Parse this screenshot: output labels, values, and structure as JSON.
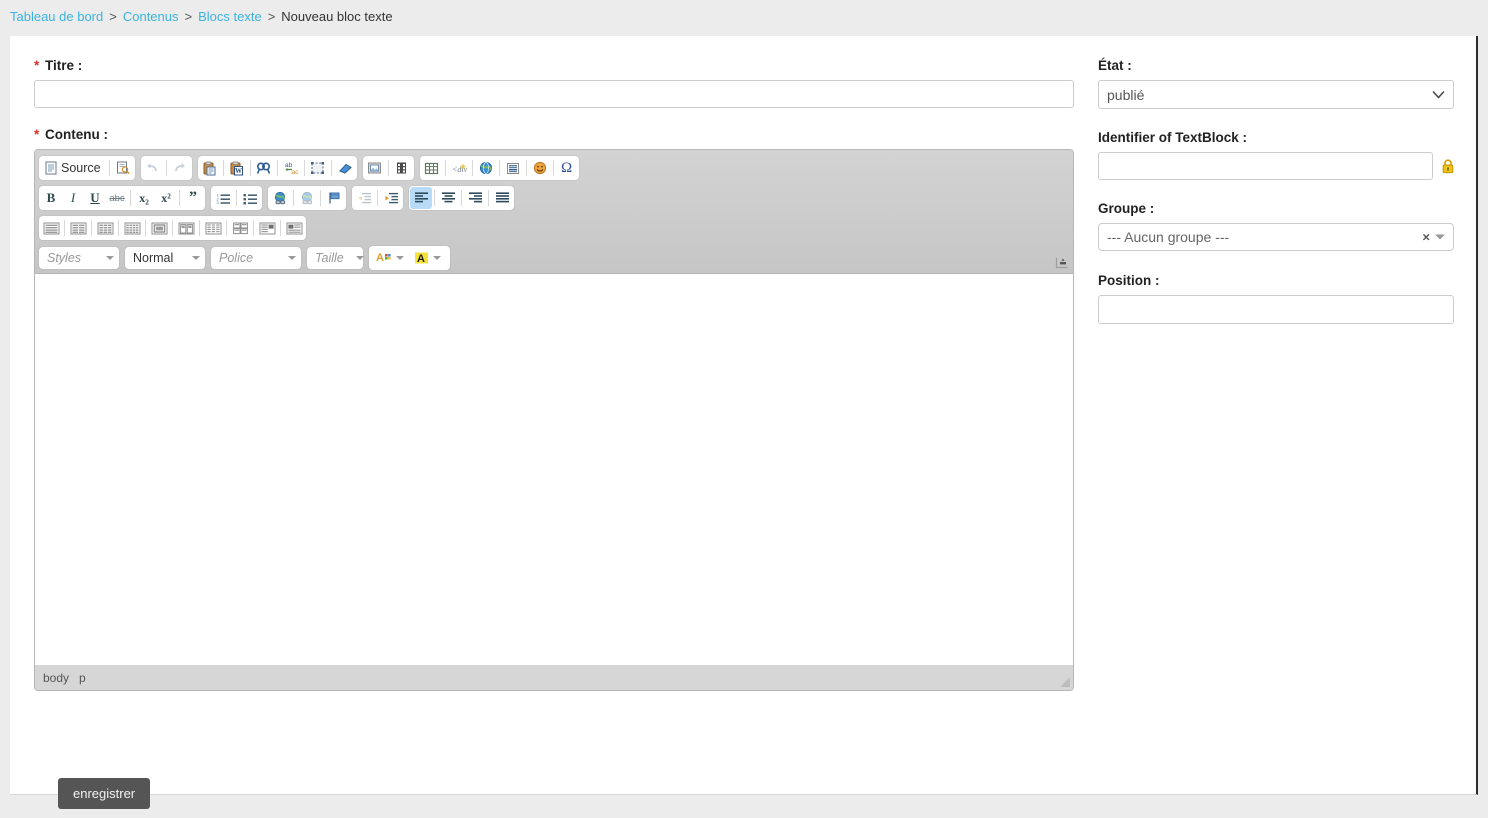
{
  "breadcrumb": {
    "items": [
      {
        "label": "Tableau de bord",
        "link": true
      },
      {
        "label": "Contenus",
        "link": true
      },
      {
        "label": "Blocs texte",
        "link": true
      },
      {
        "label": "Nouveau bloc texte",
        "link": false
      }
    ],
    "separator": ">"
  },
  "form": {
    "title_label": "Titre :",
    "title_value": "",
    "title_placeholder": "",
    "content_label": "Contenu :",
    "required_marker": "*",
    "state_label": "État :",
    "state_value": "publié",
    "state_options": [
      "publié"
    ],
    "identifier_label": "Identifier of TextBlock :",
    "identifier_value": "",
    "identifier_placeholder": "",
    "lock_icon": "lock-icon",
    "group_label": "Groupe :",
    "group_value": "--- Aucun groupe ---",
    "group_clear": "×",
    "position_label": "Position :",
    "position_value": "",
    "position_placeholder": "",
    "save_label": "enregistrer"
  },
  "editor": {
    "source_label": "Source",
    "content": "",
    "elements_path": [
      "body",
      "p"
    ],
    "combos": {
      "styles": "Styles",
      "format": "Normal",
      "font": "Police",
      "size": "Taille"
    },
    "toolbar_rows": [
      {
        "groups": [
          {
            "buttons": [
              {
                "name": "source-button",
                "label": "Source",
                "icon": "document-icon",
                "wide": true
              },
              {
                "sep": true
              },
              {
                "name": "preview-button",
                "label": "",
                "icon": "preview-icon"
              }
            ]
          },
          {
            "buttons": [
              {
                "name": "undo-button",
                "label": "",
                "icon": "undo-icon",
                "disabled": true
              },
              {
                "sep": true
              },
              {
                "name": "redo-button",
                "label": "",
                "icon": "redo-icon",
                "disabled": true
              }
            ]
          },
          {
            "buttons": [
              {
                "name": "paste-text-button",
                "label": "",
                "icon": "paste-text-icon"
              },
              {
                "sep": true
              },
              {
                "name": "paste-word-button",
                "label": "",
                "icon": "paste-word-icon"
              },
              {
                "sep": true
              },
              {
                "name": "find-button",
                "label": "",
                "icon": "find-icon"
              },
              {
                "sep": true
              },
              {
                "name": "replace-button",
                "label": "",
                "icon": "replace-icon"
              },
              {
                "sep": true
              },
              {
                "name": "select-all-button",
                "label": "",
                "icon": "select-all-icon"
              },
              {
                "sep": true
              },
              {
                "name": "remove-format-button",
                "label": "",
                "icon": "eraser-icon"
              }
            ]
          },
          {
            "buttons": [
              {
                "name": "image-button",
                "label": "",
                "icon": "image-icon"
              },
              {
                "sep": true
              },
              {
                "name": "flash-button",
                "label": "",
                "icon": "film-icon"
              }
            ]
          },
          {
            "buttons": [
              {
                "name": "table-button",
                "label": "",
                "icon": "table-icon"
              },
              {
                "sep": true
              },
              {
                "name": "div-container-button",
                "label": "",
                "icon": "div-icon"
              },
              {
                "sep": true
              },
              {
                "name": "iframe-button",
                "label": "",
                "icon": "globe-icon"
              },
              {
                "sep": true
              },
              {
                "name": "horizontal-rule-button",
                "label": "",
                "icon": "horizontal-rule-icon"
              },
              {
                "sep": true
              },
              {
                "name": "smiley-button",
                "label": "",
                "icon": "smiley-icon"
              },
              {
                "sep": true
              },
              {
                "name": "special-char-button",
                "label": "Ω",
                "icon": "omega-icon"
              }
            ]
          }
        ]
      },
      {
        "groups": [
          {
            "buttons": [
              {
                "name": "bold-button",
                "label": "B",
                "icon": "bold-icon"
              },
              {
                "name": "italic-button",
                "label": "I",
                "icon": "italic-icon"
              },
              {
                "name": "underline-button",
                "label": "U",
                "icon": "underline-icon"
              },
              {
                "name": "strike-button",
                "label": "abc",
                "icon": "strikethrough-icon"
              },
              {
                "sep": true
              },
              {
                "name": "subscript-button",
                "label": "x₂",
                "icon": "subscript-icon"
              },
              {
                "name": "superscript-button",
                "label": "x²",
                "icon": "superscript-icon"
              },
              {
                "sep": true
              },
              {
                "name": "blockquote-button",
                "label": "”",
                "icon": "quote-icon"
              }
            ]
          },
          {
            "buttons": [
              {
                "name": "numbered-list-button",
                "label": "",
                "icon": "numbered-list-icon"
              },
              {
                "sep": true
              },
              {
                "name": "bulleted-list-button",
                "label": "",
                "icon": "bulleted-list-icon"
              }
            ]
          },
          {
            "buttons": [
              {
                "name": "link-button",
                "label": "",
                "icon": "link-icon"
              },
              {
                "sep": true
              },
              {
                "name": "unlink-button",
                "label": "",
                "icon": "unlink-icon"
              },
              {
                "sep": true
              },
              {
                "name": "anchor-button",
                "label": "",
                "icon": "anchor-flag-icon"
              }
            ]
          },
          {
            "buttons": [
              {
                "name": "outdent-button",
                "label": "",
                "icon": "outdent-icon",
                "disabled": true
              },
              {
                "sep": true
              },
              {
                "name": "indent-button",
                "label": "",
                "icon": "indent-icon"
              }
            ]
          },
          {
            "buttons": [
              {
                "name": "align-left-button",
                "label": "",
                "icon": "align-left-icon",
                "active": true
              },
              {
                "sep": true
              },
              {
                "name": "align-center-button",
                "label": "",
                "icon": "align-center-icon"
              },
              {
                "sep": true
              },
              {
                "name": "align-right-button",
                "label": "",
                "icon": "align-right-icon"
              },
              {
                "sep": true
              },
              {
                "name": "align-justify-button",
                "label": "",
                "icon": "align-justify-icon"
              }
            ]
          }
        ]
      },
      {
        "groups": [
          {
            "buttons": [
              {
                "name": "layout-1col-button",
                "label": "",
                "icon": "layout-1col-icon"
              },
              {
                "sep": true
              },
              {
                "name": "layout-2col-button",
                "label": "",
                "icon": "layout-2col-icon"
              },
              {
                "sep": true
              },
              {
                "name": "layout-3col-button",
                "label": "",
                "icon": "layout-3col-icon"
              },
              {
                "sep": true
              },
              {
                "name": "layout-4col-button",
                "label": "",
                "icon": "layout-4col-icon"
              },
              {
                "sep": true
              },
              {
                "name": "layout-frame-button",
                "label": "",
                "icon": "layout-frame-icon"
              },
              {
                "sep": true
              },
              {
                "name": "layout-split-button",
                "label": "",
                "icon": "layout-split-icon"
              },
              {
                "sep": true
              },
              {
                "name": "layout-grid-button",
                "label": "",
                "icon": "layout-grid-icon"
              },
              {
                "sep": true
              },
              {
                "name": "layout-quad-button",
                "label": "",
                "icon": "layout-quad-icon"
              },
              {
                "sep": true
              },
              {
                "name": "layout-media-left-button",
                "label": "",
                "icon": "layout-media-left-icon"
              },
              {
                "sep": true
              },
              {
                "name": "layout-media-right-button",
                "label": "",
                "icon": "layout-media-right-icon"
              }
            ]
          }
        ]
      }
    ],
    "color_buttons": [
      {
        "name": "text-color-button",
        "icon": "text-color-icon"
      },
      {
        "name": "bg-color-button",
        "icon": "background-color-icon"
      }
    ]
  },
  "colors": {
    "page_background": "#ececec",
    "card_background": "#ffffff",
    "link": "#3bb3e0",
    "required": "#d9322c",
    "toolbar": "#cfcfcf",
    "toolbar_active": "#b8dcf7",
    "save_button": "#555555",
    "lock": "#e5b80b",
    "status_bar": "#d6d6d6"
  }
}
